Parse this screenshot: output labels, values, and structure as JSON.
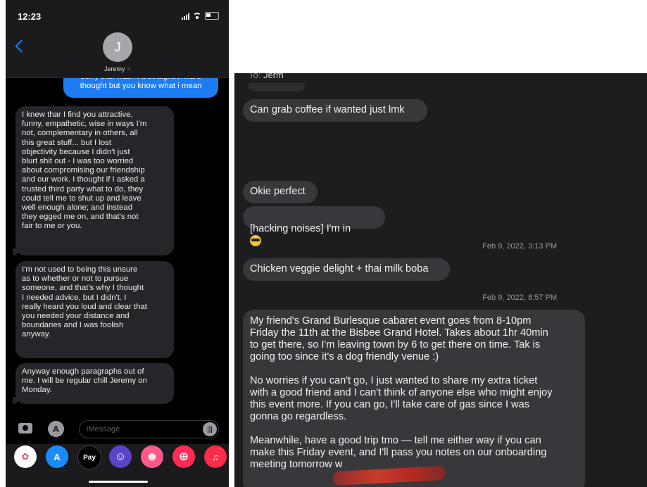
{
  "left": {
    "status": {
      "time": "12:23"
    },
    "contact": {
      "initial": "J",
      "name": "Jeremy",
      "chevron": ">"
    },
    "messages": [
      {
        "dir": "out",
        "text": "sorry that wasn't a straightforward\nthought but you know what i mean"
      },
      {
        "dir": "in",
        "text": "I knew thar I find you attractive,\nfunny, empathetic, wise in ways I'm\nnot, complementary in others, all\nthis great stuff... but I lost\nobjectivity because I didn't just\nblurt shit out - I was too worried\nabout compromising our friendship\nand our work. I thought if I asked a\ntrusted third party what to do, they\ncould tell me to shut up and leave\nwell enough alone; and instead\nthey egged me on, and that's not\nfair to me or you."
      },
      {
        "dir": "in",
        "text": "I'm not used to being this unsure\nas to whether or not to pursue\nsomeone, and that's why I thought\nI needed advice, but I didn't. I\nreally heard you loud and clear that\nyou needed your distance and\nboundaries and I was foolish\nanyway."
      },
      {
        "dir": "in",
        "text": "Anyway enough paragraphs out of\nme. I will be regular chill Jeremy on\nMonday."
      }
    ],
    "input": {
      "placeholder": "iMessage"
    },
    "apps": [
      {
        "icon": "photos-icon",
        "glyph": "✿",
        "color": "#ffffff"
      },
      {
        "icon": "app-store-icon",
        "glyph": "A",
        "color": "#1a8cff"
      },
      {
        "icon": "apple-pay-icon",
        "glyph": "Pay",
        "color": "#000000"
      },
      {
        "icon": "memoji-icon",
        "glyph": "☺",
        "color": "#6a4bd0"
      },
      {
        "icon": "memoji-stickers-icon",
        "glyph": "☻",
        "color": "#ff5a8a"
      },
      {
        "icon": "search-images-icon",
        "glyph": "⊕",
        "color": "#ff2d55"
      },
      {
        "icon": "music-icon",
        "glyph": "♫",
        "color": "#fa2d48"
      }
    ]
  },
  "right": {
    "to_prefix": "To:",
    "to_name": "Jerm",
    "messages": [
      {
        "type": "bubble",
        "text": "Can grab coffee if wanted just lmk"
      },
      {
        "type": "bubble",
        "text": "Okie perfect"
      },
      {
        "type": "bubble",
        "text": "[hacking noises] I'm in"
      },
      {
        "type": "timestamp",
        "text": "Feb 9, 2022, 3:13 PM"
      },
      {
        "type": "bubble",
        "text": "Chicken veggie delight + thai milk boba"
      },
      {
        "type": "timestamp",
        "text": "Feb 9, 2022, 8:57 PM"
      },
      {
        "type": "bubble",
        "text": "My friend's Grand Burlesque cabaret event goes from 8-10pm\nFriday the 11th at the Bisbee Grand Hotel. Takes about 1hr 40min\nto get there, so I'm leaving town by 6 to get there on time. Tak is\ngoing too since it's a dog friendly venue :)\n\nNo worries if you can't go, I just wanted to share my extra ticket\nwith a good friend and I can't think of anyone else who might enjoy\nthis event more. If you can go, I'll take care of gas since I was\ngonna go regardless.\n\nMeanwhile, have a good trip tmo — tell me either way if you can\nmake this Friday event, and I'll pass you notes on our onboarding\nmeeting tomorrow w"
      }
    ]
  }
}
